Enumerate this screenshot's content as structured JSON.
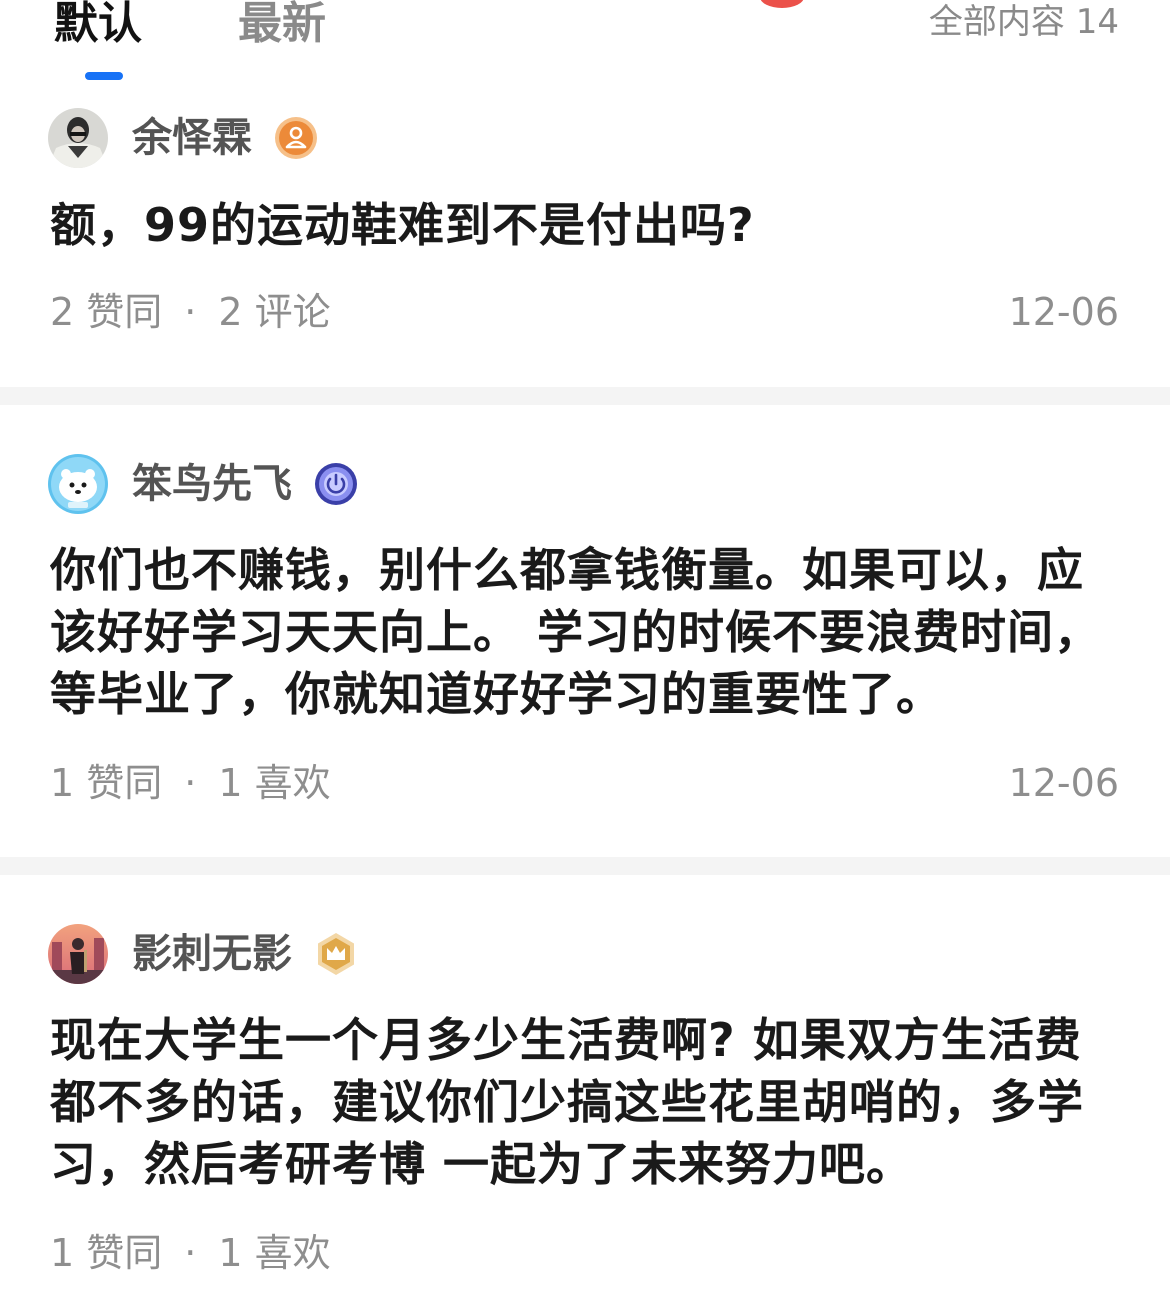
{
  "tabs": {
    "default_label": "默认",
    "latest_label": "最新",
    "total_label": "全部内容 14"
  },
  "colors": {
    "accent": "#1772f6",
    "text_primary": "#1a1a1a",
    "text_secondary": "#8e8e8e",
    "divider": "#f4f4f4"
  },
  "answers": [
    {
      "author": "余怿霖",
      "badge": "person-badge-icon",
      "text": "额，99的运动鞋难到不是付出吗?",
      "likes": "2 赞同",
      "second_stat": "2 评论",
      "date": "12-06"
    },
    {
      "author": "笨鸟先飞",
      "badge": "power-badge-icon",
      "text": "你们也不赚钱，别什么都拿钱衡量。如果可以，应该好好学习天天向上。 学习的时候不要浪费时间，等毕业了，你就知道好好学习的重要性了。",
      "likes": "1 赞同",
      "second_stat": "1 喜欢",
      "date": "12-06"
    },
    {
      "author": "影刺无影",
      "badge": "crown-badge-icon",
      "text": "现在大学生一个月多少生活费啊? 如果双方生活费都不多的话，建议你们少搞这些花里胡哨的，多学习，然后考研考博 一起为了未来努力吧。",
      "likes": "1 赞同",
      "second_stat": "1 喜欢",
      "date": ""
    }
  ]
}
